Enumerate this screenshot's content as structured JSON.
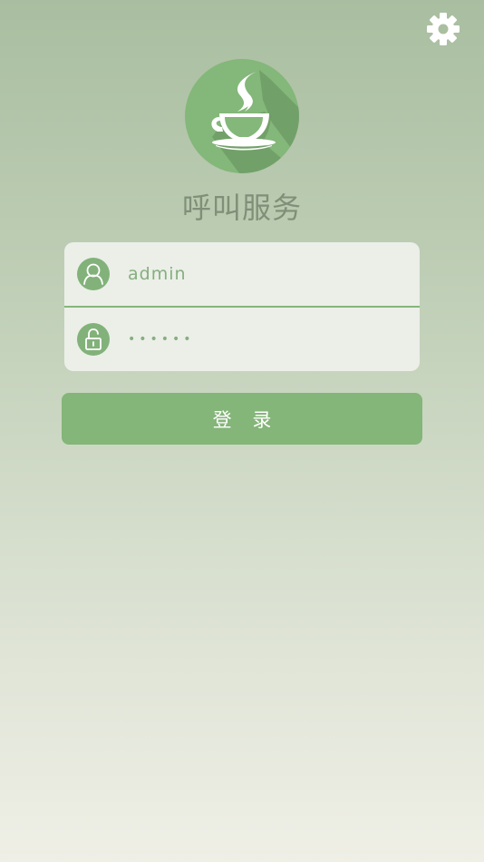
{
  "app": {
    "title": "呼叫服务"
  },
  "icons": {
    "settings": "gear-icon",
    "logo": "coffee-cup-icon",
    "user": "user-icon",
    "password": "unlock-icon"
  },
  "login_form": {
    "username_value": "admin",
    "password_value": "123456",
    "submit_label": "登 录"
  },
  "colors": {
    "accent": "#84b579",
    "title_text": "#7f8f78",
    "input_text": "#86ae7e",
    "card_background": "#ebefe8"
  }
}
